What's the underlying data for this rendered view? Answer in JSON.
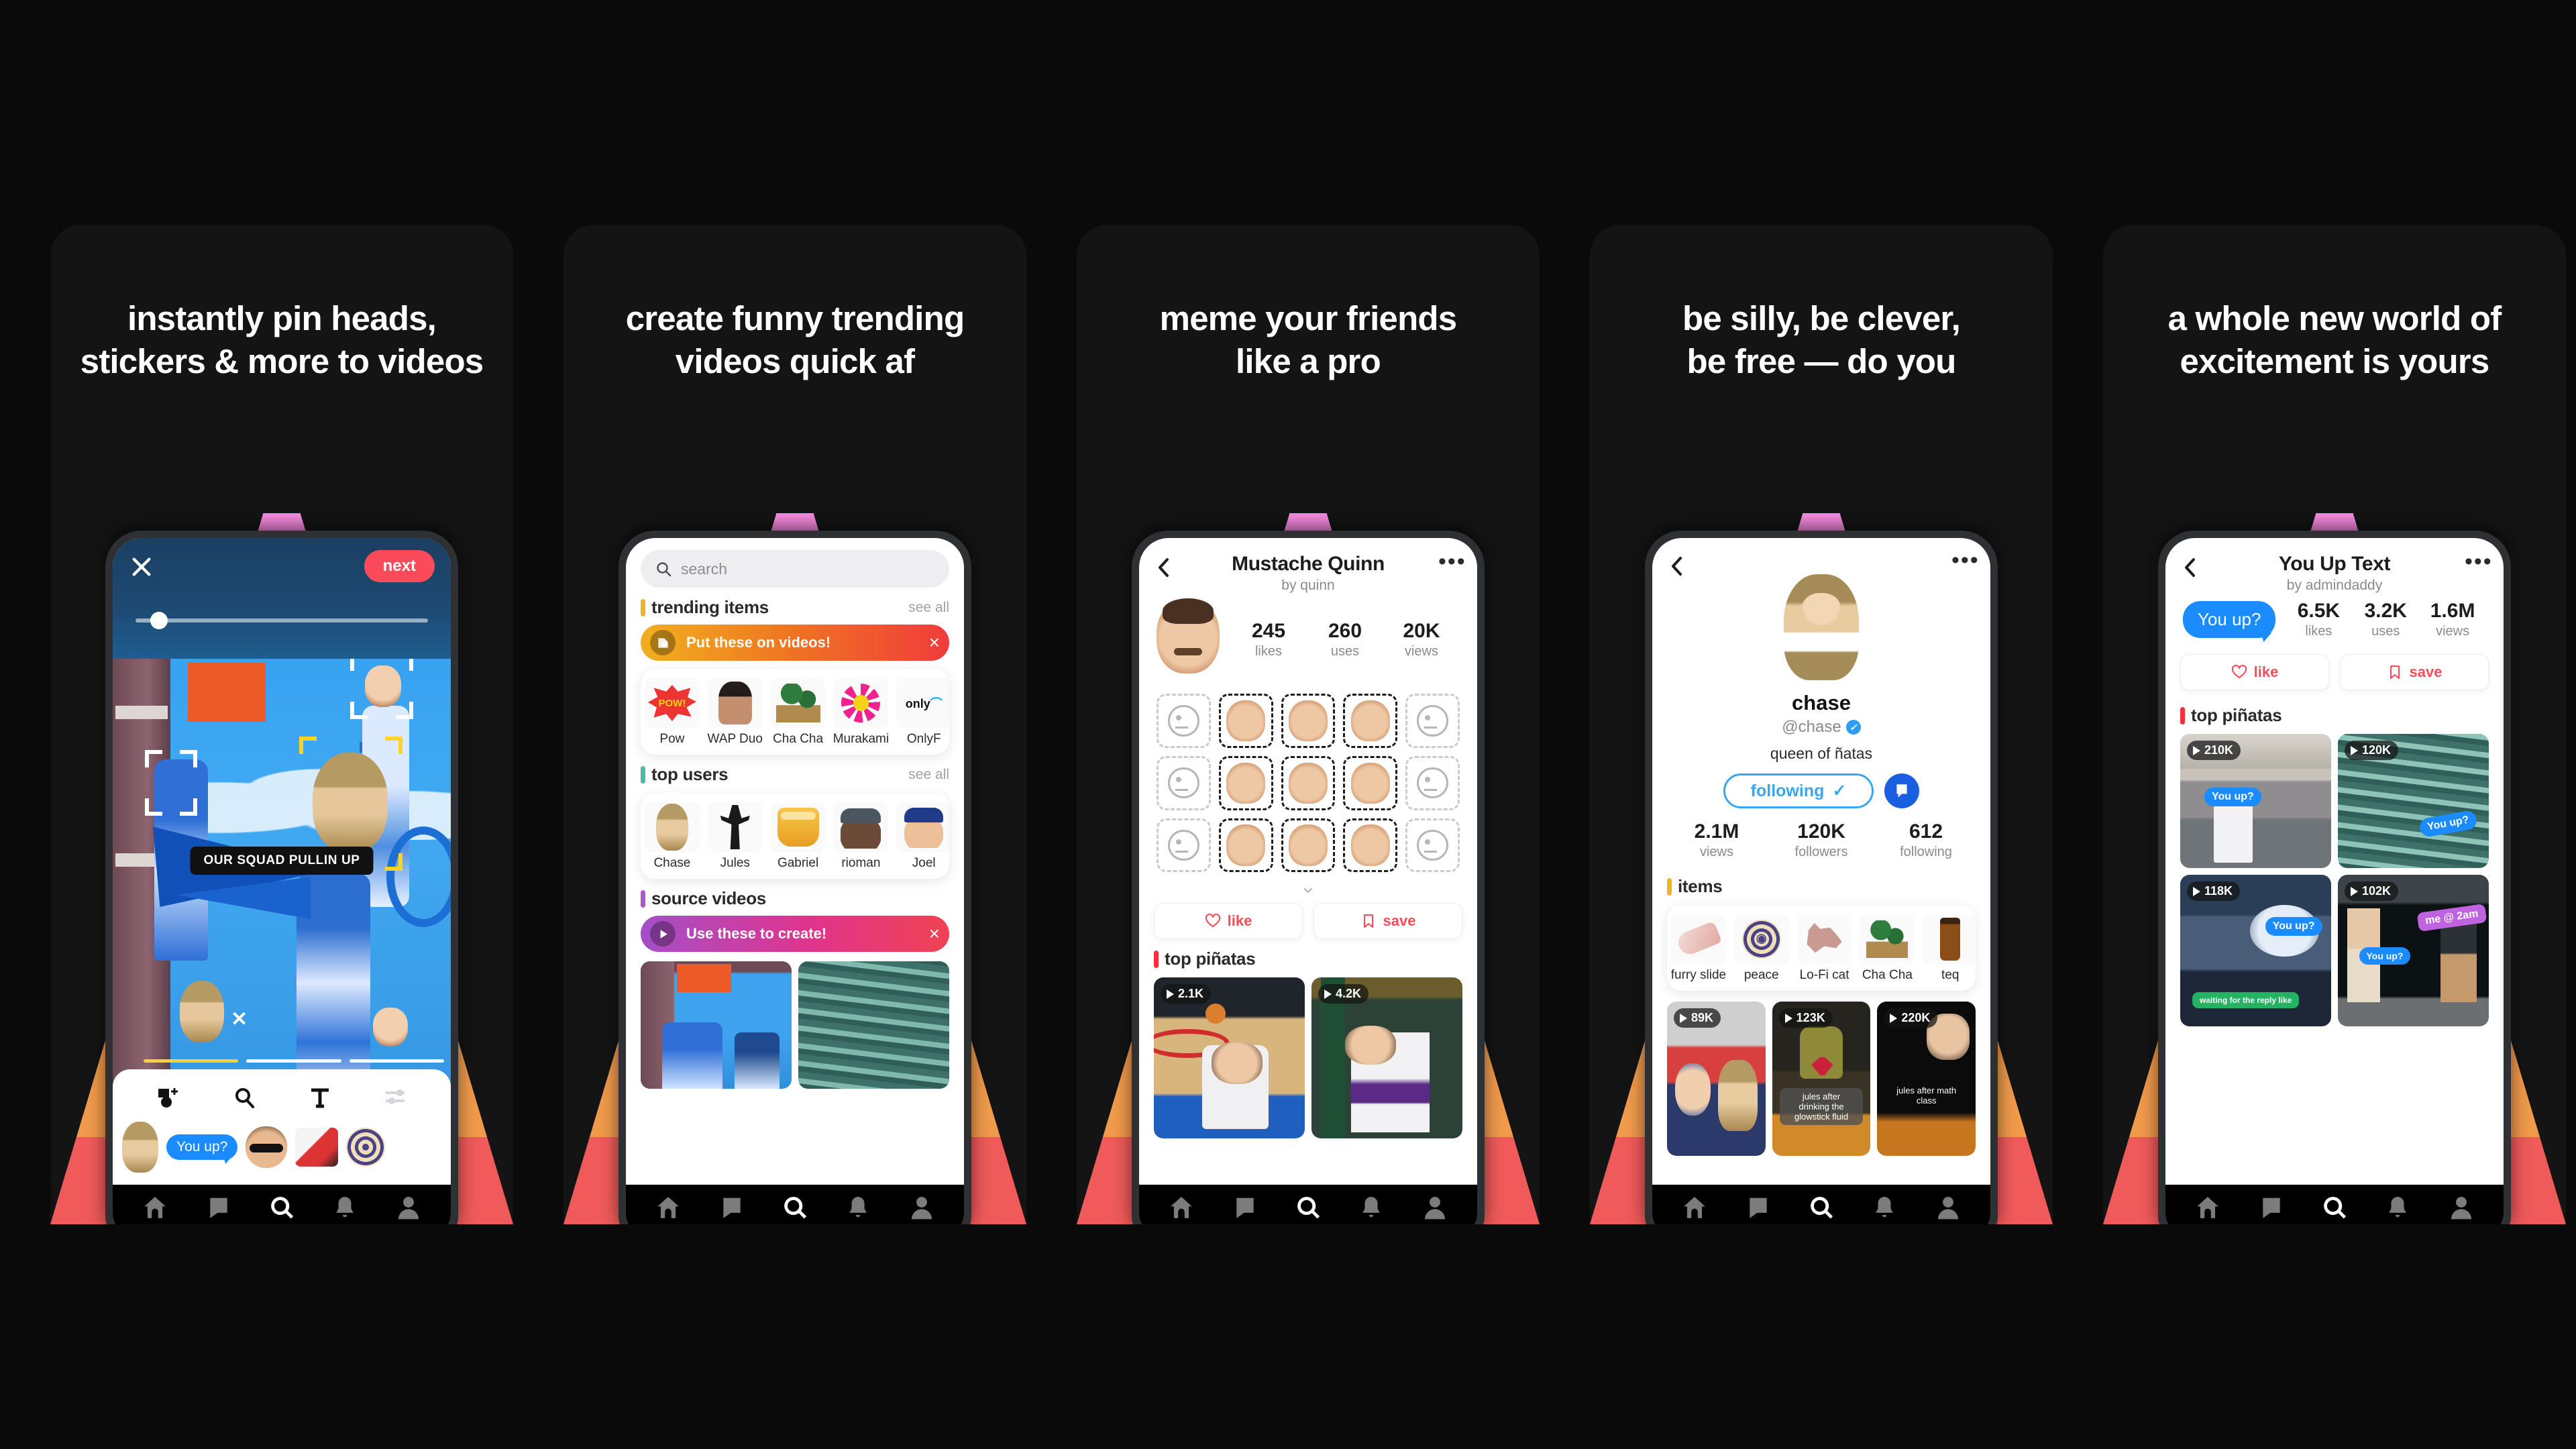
{
  "panels": [
    {
      "headline": "instantly pin heads,\nstickers & more to videos",
      "app": "editor",
      "editor": {
        "close_icon": "close-icon",
        "next_label": "next",
        "caption": "OUR SQUAD PULLIN UP",
        "delete_sticker_icon": "close-icon",
        "tools": [
          "add-media-icon",
          "search-icon",
          "text-icon",
          "adjust-icon"
        ],
        "stickers": [
          "girl-head-sticker",
          "You up?",
          "guy-sunglasses-sticker",
          "sneaker-sticker",
          "peace-target-sticker"
        ]
      }
    },
    {
      "headline": "create funny trending\nvideos quick af",
      "app": "search",
      "search": {
        "placeholder": "search",
        "sections": [
          {
            "title": "trending items",
            "see_all": "see all",
            "accent": "#f0b429",
            "banner": {
              "label": "Put these on videos!",
              "icon": "sticker-icon",
              "close": "×"
            },
            "items": [
              {
                "label": "Pow",
                "art": "pow"
              },
              {
                "label": "WAP Duo",
                "art": "wap"
              },
              {
                "label": "Cha Cha",
                "art": "palms"
              },
              {
                "label": "Murakami",
                "art": "flower"
              },
              {
                "label": "OnlyF",
                "art": "onlyfans"
              }
            ]
          },
          {
            "title": "top users",
            "see_all": "see all",
            "accent": "#4cb8a8",
            "items": [
              {
                "label": "Chase",
                "art": "girl"
              },
              {
                "label": "Jules",
                "art": "ape"
              },
              {
                "label": "Gabriel",
                "art": "honey"
              },
              {
                "label": "rioman",
                "art": "cap"
              },
              {
                "label": "Joel",
                "art": "joel"
              }
            ]
          },
          {
            "title": "source videos",
            "accent": "#b055d0",
            "banner": {
              "label": "Use these to create!",
              "icon": "play-icon",
              "close": "×"
            },
            "videos": [
              "runway-blue",
              "underwater-teal"
            ]
          }
        ]
      }
    },
    {
      "headline": "meme your friends\nlike a pro",
      "app": "pack",
      "pack": {
        "title": "Mustache Quinn",
        "subtitle": "by quinn",
        "back_icon": "chevron-left-icon",
        "more_icon": "more-icon",
        "avatar": "quinn-head",
        "stats": [
          {
            "num": "245",
            "label": "likes"
          },
          {
            "num": "260",
            "label": "uses"
          },
          {
            "num": "20K",
            "label": "views"
          }
        ],
        "grid_rows": 3,
        "grid_cols": 5,
        "expand_icon": "chevron-down-icon",
        "like_label": "like",
        "save_label": "save",
        "section_title": "top piñatas",
        "section_accent": "#fb2c3b",
        "videos": [
          {
            "views": "2.1K",
            "art": "basketball-dunk"
          },
          {
            "views": "4.2K",
            "art": "football-vikings"
          }
        ]
      }
    },
    {
      "headline": "be silly, be clever,\nbe free — do you",
      "app": "profile",
      "profile": {
        "back_icon": "chevron-left-icon",
        "more_icon": "more-icon",
        "avatar": "chase-avatar",
        "name": "chase",
        "handle": "@chase",
        "verified": true,
        "bio": "queen of ñatas",
        "follow_label": "following",
        "follow_check": "✓",
        "message_icon": "message-icon",
        "stats": [
          {
            "num": "2.1M",
            "label": "views"
          },
          {
            "num": "120K",
            "label": "followers"
          },
          {
            "num": "612",
            "label": "following"
          }
        ],
        "items_title": "items",
        "items_accent": "#f0b429",
        "items": [
          {
            "label": "furry slide",
            "art": "slide"
          },
          {
            "label": "peace",
            "art": "peace"
          },
          {
            "label": "Lo-Fi cat",
            "art": "cat"
          },
          {
            "label": "Cha Cha",
            "art": "palms"
          },
          {
            "label": "teq",
            "art": "bottle"
          }
        ],
        "videos": [
          {
            "views": "89K",
            "art": "couple-flag",
            "caption": ""
          },
          {
            "views": "123K",
            "art": "concert",
            "caption": "jules after drinking the glowstick fluid"
          },
          {
            "views": "220K",
            "art": "night-crowd",
            "caption": "jules after math class"
          }
        ]
      }
    },
    {
      "headline": "a whole new world of\nexcitement is yours",
      "app": "textpack",
      "textpack": {
        "title": "You Up Text",
        "subtitle": "by admindaddy",
        "back_icon": "chevron-left-icon",
        "more_icon": "more-icon",
        "hero_bubble": "You up?",
        "stats": [
          {
            "num": "6.5K",
            "label": "likes"
          },
          {
            "num": "3.2K",
            "label": "uses"
          },
          {
            "num": "1.6M",
            "label": "views"
          }
        ],
        "like_label": "like",
        "save_label": "save",
        "section_title": "top piñatas",
        "section_accent": "#fb2c3b",
        "videos": [
          {
            "views": "210K",
            "art": "gym-hoop",
            "overlays": [
              {
                "text": "You up?",
                "style": "blue"
              }
            ]
          },
          {
            "views": "120K",
            "art": "underwater",
            "overlays": [
              {
                "text": "You up?",
                "style": "blue"
              }
            ]
          },
          {
            "views": "118K",
            "art": "night-moon",
            "overlays": [
              {
                "text": "You up?",
                "style": "blue"
              },
              {
                "text": "waiting for the reply like",
                "style": "green"
              }
            ]
          },
          {
            "views": "102K",
            "art": "driving-range",
            "overlays": [
              {
                "text": "me @ 2am",
                "style": "purple"
              },
              {
                "text": "You up?",
                "style": "blue"
              }
            ]
          }
        ]
      }
    }
  ],
  "tabbar": {
    "items": [
      {
        "icon": "home-icon",
        "active": false
      },
      {
        "icon": "chat-icon",
        "active": false
      },
      {
        "icon": "search-icon",
        "active": true
      },
      {
        "icon": "bell-icon",
        "active": false
      },
      {
        "icon": "profile-icon",
        "active": false
      }
    ]
  },
  "theme": {
    "background": "#0a0a0a",
    "panel": "#141414",
    "accent_red": "#fb4a59",
    "accent_blue": "#1a8cff",
    "rainbow": [
      "#ff8fe8",
      "#b661e0",
      "#54cdf0",
      "#2cb563",
      "#f3cf4a",
      "#f09a4b",
      "#f05a5a"
    ]
  }
}
